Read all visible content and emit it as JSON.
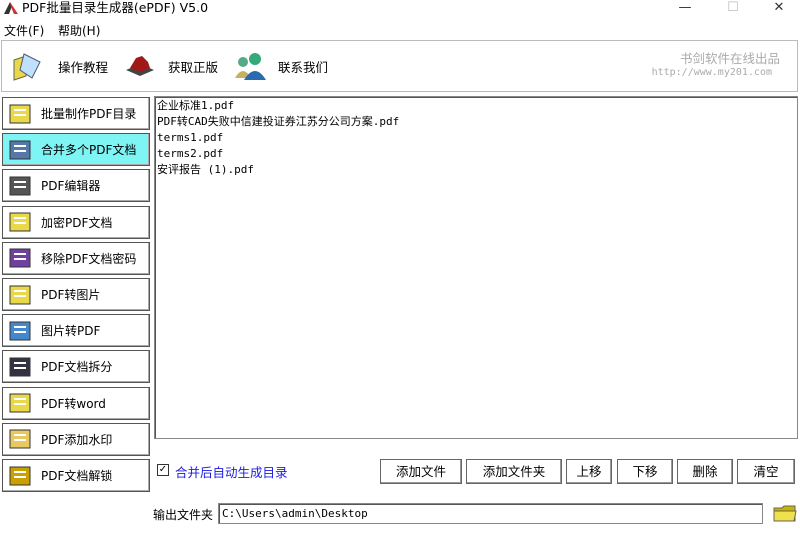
{
  "window": {
    "title": "PDF批量目录生成器(ePDF) V5.0",
    "minimize": "—",
    "maximize": "☐",
    "close": "✕"
  },
  "menu": [
    "文件(F)",
    "帮助(H)"
  ],
  "toolbar": {
    "items": [
      "操作教程",
      "获取正版",
      "联系我们"
    ],
    "brand_line1": "书剑软件在线出品",
    "brand_line2": "http://www.my201.com"
  },
  "sidebar": {
    "items": [
      "批量制作PDF目录",
      "合并多个PDF文档",
      "PDF编辑器",
      "加密PDF文档",
      "移除PDF文档密码",
      "PDF转图片",
      "图片转PDF",
      "PDF文档拆分",
      "PDF转word",
      "PDF添加水印",
      "PDF文档解锁"
    ],
    "active_index": 1
  },
  "files": [
    "企业标准1.pdf",
    "PDF转CAD失败中信建投证券江苏分公司方案.pdf",
    "terms1.pdf",
    "terms2.pdf",
    "安评报告 (1).pdf"
  ],
  "options": {
    "auto_toc_label": "合并后自动生成目录",
    "auto_toc_checked": true,
    "check_mark": "✓"
  },
  "buttons": {
    "add_file": "添加文件",
    "add_folder": "添加文件夹",
    "move_up": "上移",
    "move_down": "下移",
    "delete": "删除",
    "clear": "清空"
  },
  "output": {
    "label": "输出文件夹",
    "value": "C:\\Users\\admin\\Desktop"
  },
  "colors": {
    "active": "#7ff4f4",
    "link": "#1a1ae6"
  }
}
